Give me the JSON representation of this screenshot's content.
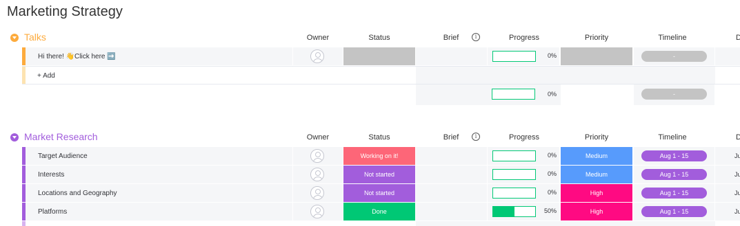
{
  "page_title": "Marketing Strategy",
  "columns": {
    "owner": "Owner",
    "status": "Status",
    "brief": "Brief",
    "info": "i",
    "progress": "Progress",
    "priority": "Priority",
    "timeline": "Timeline",
    "date": "D"
  },
  "colors": {
    "talks": "#fdab3d",
    "market_research": "#a25ddc",
    "working": "#fd6678",
    "not_started": "#a25ddc",
    "done": "#00c875",
    "medium": "#579bfc",
    "high": "#ff0a82",
    "empty": "#c4c4c4",
    "progress": "#00c875"
  },
  "groups": [
    {
      "title": "Talks",
      "rows": [
        {
          "name": "Hi there! 👋Click here ➡️",
          "status": "",
          "progress": "0%",
          "progress_value": 0,
          "priority": "",
          "timeline": "-",
          "date": ""
        }
      ],
      "add_label": "+ Add",
      "summary": {
        "progress": "0%",
        "progress_value": 0,
        "timeline": "-"
      }
    },
    {
      "title": "Market Research",
      "rows": [
        {
          "name": "Target Audience",
          "status": "Working on it!",
          "progress": "0%",
          "progress_value": 0,
          "priority": "Medium",
          "timeline": "Aug 1 - 15",
          "date": "Ju"
        },
        {
          "name": "Interests",
          "status": "Not started",
          "progress": "0%",
          "progress_value": 0,
          "priority": "Medium",
          "timeline": "Aug 1 - 15",
          "date": "Ju"
        },
        {
          "name": "Locations and Geography",
          "status": "Not started",
          "progress": "0%",
          "progress_value": 0,
          "priority": "High",
          "timeline": "Aug 1 - 15",
          "date": "Ju"
        },
        {
          "name": "Platforms",
          "status": "Done",
          "progress": "50%",
          "progress_value": 0.5,
          "priority": "High",
          "timeline": "Aug 1 - 15",
          "date": "Ju"
        }
      ]
    }
  ]
}
